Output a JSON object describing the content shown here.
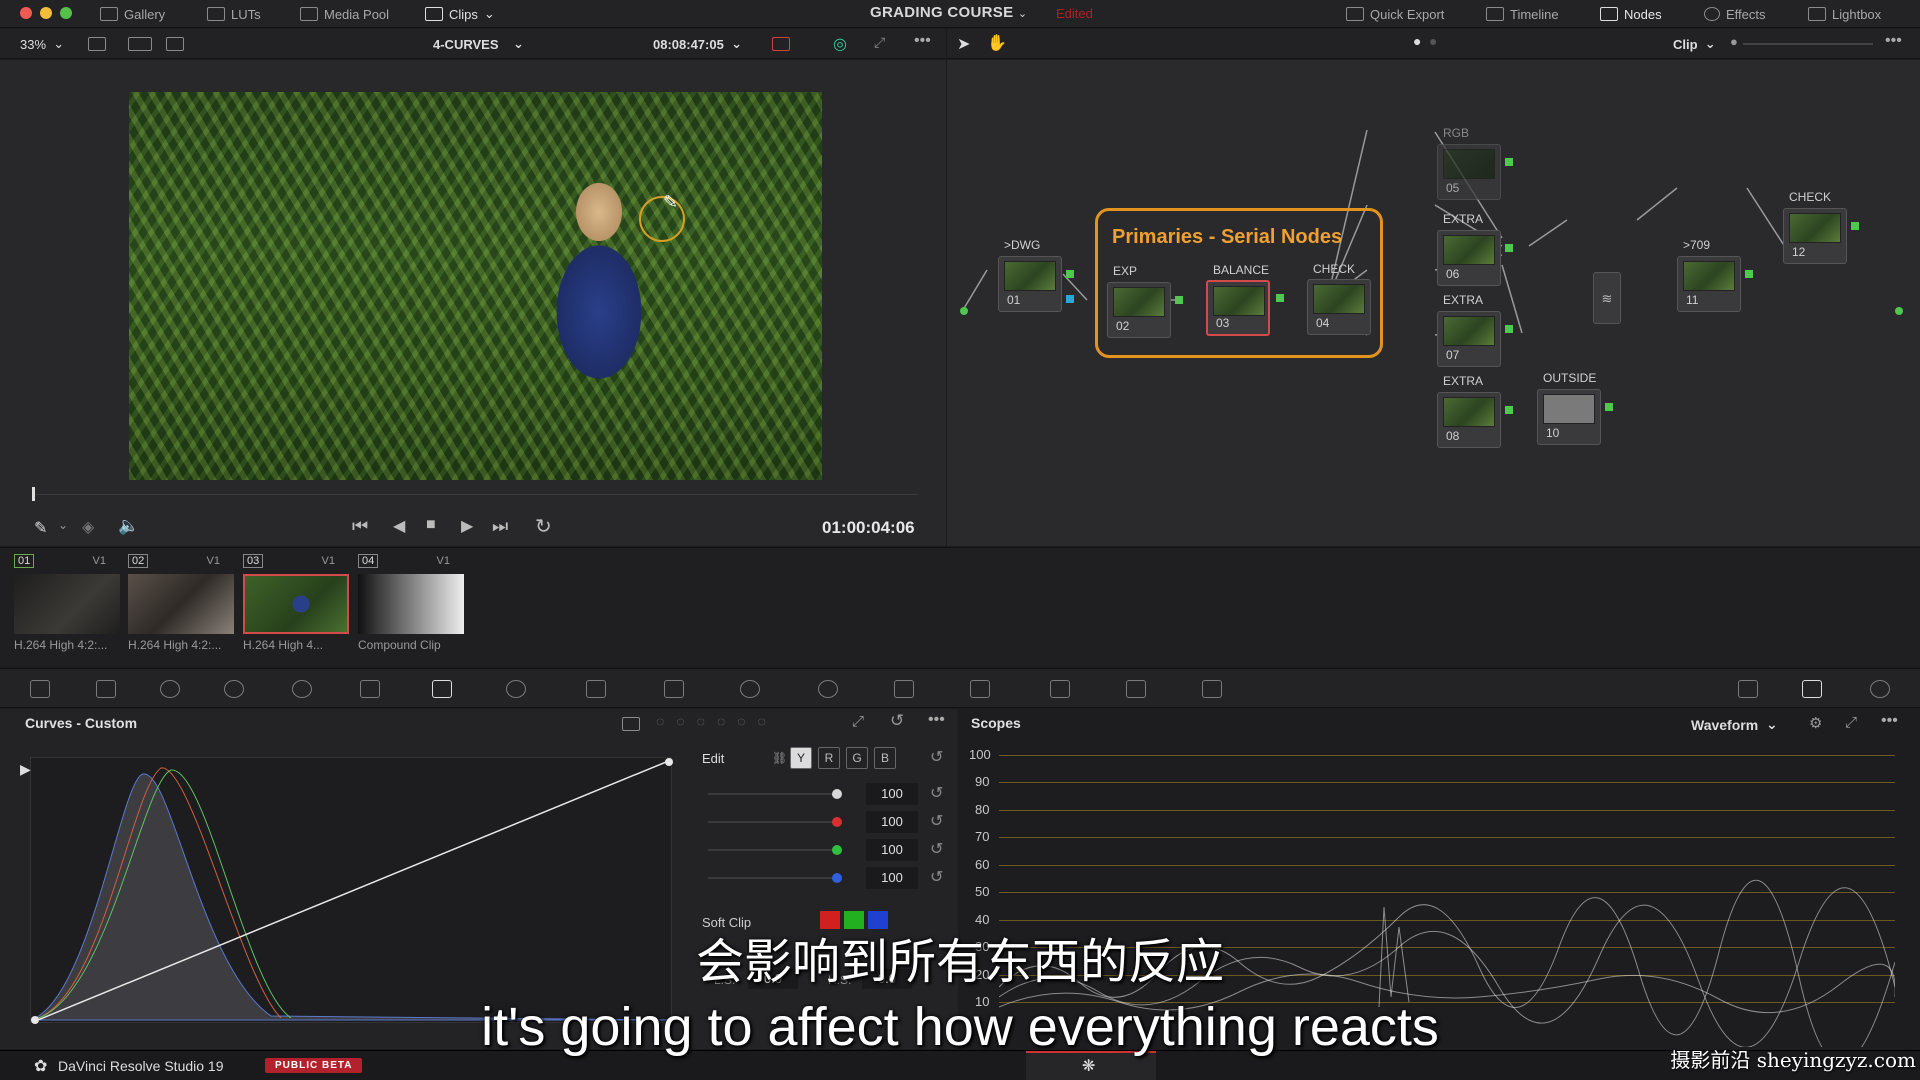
{
  "topbar": {
    "left_tabs": [
      "Gallery",
      "LUTs",
      "Media Pool",
      "Clips"
    ],
    "project_title": "GRADING COURSE",
    "project_status": "Edited",
    "right_tabs": [
      "Quick Export",
      "Timeline",
      "Nodes",
      "Effects",
      "Lightbox"
    ]
  },
  "viewer": {
    "zoom": "33%",
    "timeline_name": "4-CURVES",
    "source_timecode": "08:08:47:05",
    "record_timecode": "01:00:04:06"
  },
  "nodes": {
    "clip_mode": "Clip",
    "group_title": "Primaries - Serial Nodes",
    "items": [
      {
        "label": ">DWG",
        "num": "01"
      },
      {
        "label": "EXP",
        "num": "02"
      },
      {
        "label": "BALANCE",
        "num": "03"
      },
      {
        "label": "CHECK",
        "num": "04"
      },
      {
        "label": "RGB",
        "num": "05"
      },
      {
        "label": "EXTRA",
        "num": "06"
      },
      {
        "label": "EXTRA",
        "num": "07"
      },
      {
        "label": "EXTRA",
        "num": "08"
      },
      {
        "label": "OUTSIDE",
        "num": "10"
      },
      {
        "label": ">709",
        "num": "11"
      },
      {
        "label": "CHECK",
        "num": "12"
      }
    ]
  },
  "gallery": {
    "clips": [
      {
        "num": "01",
        "track": "V1",
        "codec": "H.264 High 4:2:..."
      },
      {
        "num": "02",
        "track": "V1",
        "codec": "H.264 High 4:2:..."
      },
      {
        "num": "03",
        "track": "V1",
        "codec": "H.264 High 4..."
      },
      {
        "num": "04",
        "track": "V1",
        "codec": "Compound Clip"
      }
    ]
  },
  "curves": {
    "title": "Curves - Custom",
    "edit_label": "Edit",
    "channels": [
      "Y",
      "R",
      "G",
      "B"
    ],
    "values": [
      "100",
      "100",
      "100",
      "100"
    ],
    "soft_clip_label": "Soft Clip",
    "ls_label": "L.S.",
    "ls_value": "0.0",
    "hs_label": "H.S.",
    "hs_value": "0.0",
    "dot_colors": [
      "#d8d8d8",
      "#d83030",
      "#30c040",
      "#3060e0"
    ]
  },
  "scopes": {
    "title": "Scopes",
    "mode": "Waveform",
    "scale": [
      "100",
      "90",
      "80",
      "70",
      "60",
      "50",
      "40",
      "30",
      "20",
      "10"
    ]
  },
  "bottombar": {
    "app_name": "DaVinci Resolve Studio 19",
    "badge": "PUBLIC BETA"
  },
  "subtitles": {
    "cn": "会影响到所有东西的反应",
    "en": "it's going to affect how everything reacts"
  },
  "watermark": "摄影前沿 sheyingzyz.com"
}
